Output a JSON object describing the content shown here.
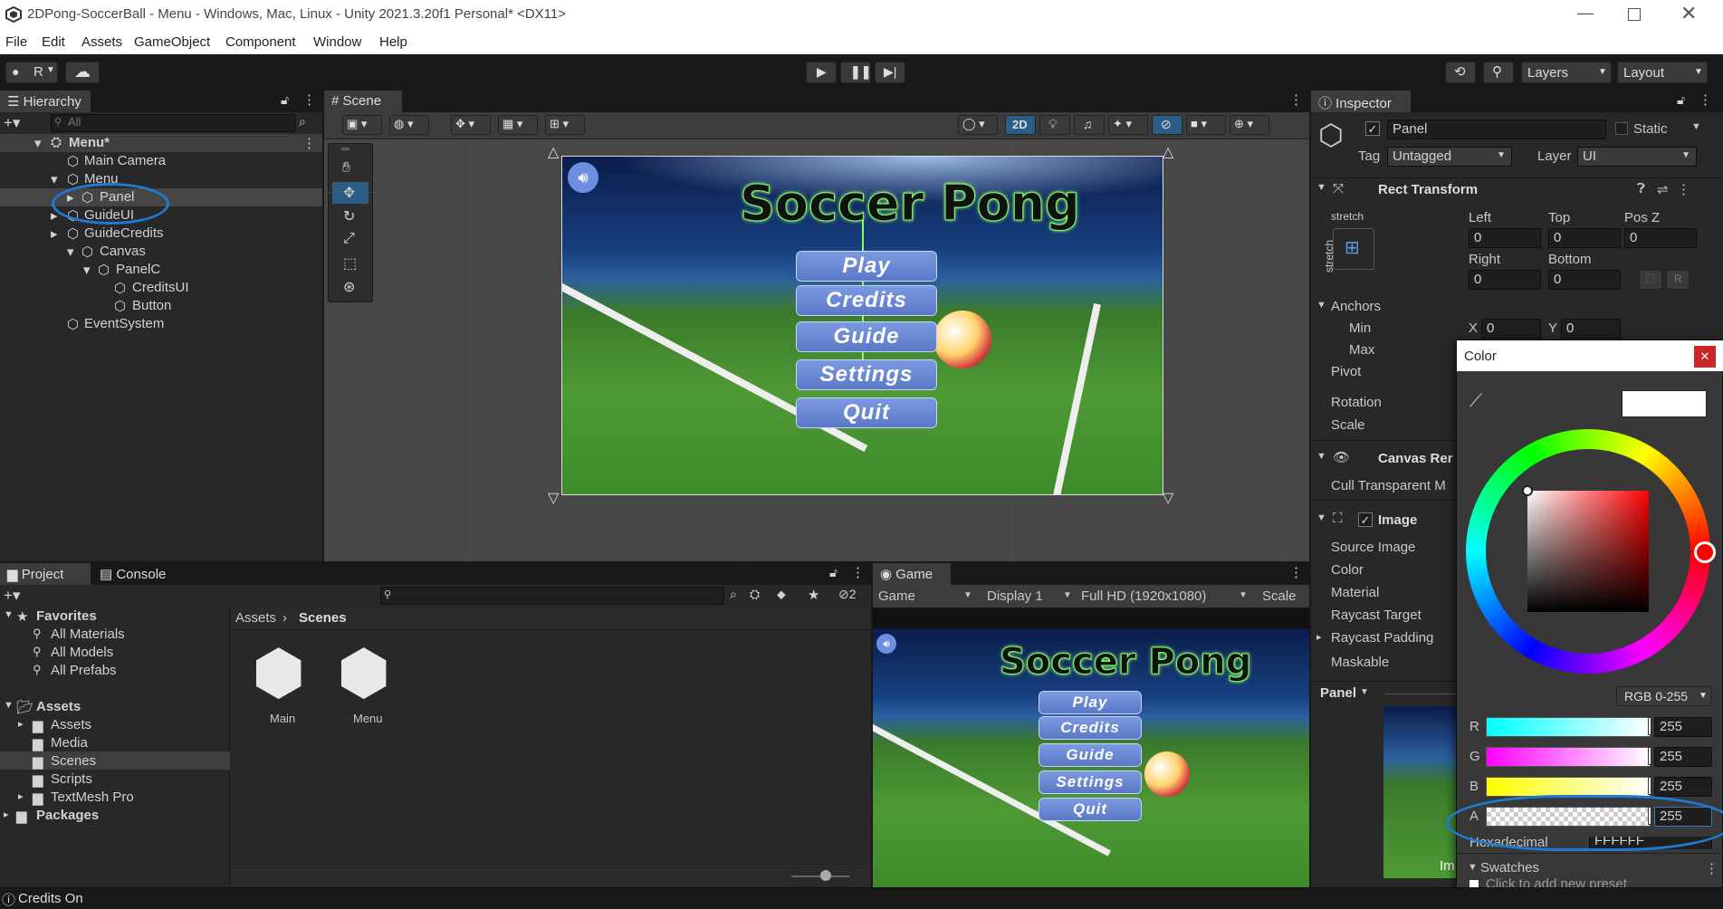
{
  "window": {
    "title": "2DPong-SoccerBall - Menu - Windows, Mac, Linux - Unity 2021.3.20f1 Personal* <DX11>"
  },
  "menubar": [
    "File",
    "Edit",
    "Assets",
    "GameObject",
    "Component",
    "Window",
    "Help"
  ],
  "toolbar": {
    "account": "R",
    "layers": "Layers",
    "layout": "Layout"
  },
  "hierarchy": {
    "tab": "Hierarchy",
    "search_placeholder": "All",
    "items": [
      {
        "label": "Menu*"
      },
      {
        "label": "Main Camera"
      },
      {
        "label": "Menu"
      },
      {
        "label": "Panel"
      },
      {
        "label": "GuideUI"
      },
      {
        "label": "GuideCredits"
      },
      {
        "label": "Canvas"
      },
      {
        "label": "PanelC"
      },
      {
        "label": "CreditsUI"
      },
      {
        "label": "Button"
      },
      {
        "label": "EventSystem"
      }
    ]
  },
  "scene": {
    "tab": "Scene",
    "mode2d": "2D"
  },
  "game_ui": {
    "title": "Soccer Pong",
    "buttons": [
      "Play",
      "Credits",
      "Guide",
      "Settings",
      "Quit"
    ]
  },
  "inspector": {
    "tab": "Inspector",
    "name": "Panel",
    "static_label": "Static",
    "tag_label": "Tag",
    "tag_value": "Untagged",
    "layer_label": "Layer",
    "layer_value": "UI",
    "rect_transform": "Rect Transform",
    "stretch_top": "stretch",
    "stretch_side": "stretch",
    "fields": {
      "left": "Left",
      "top": "Top",
      "posz": "Pos Z",
      "right": "Right",
      "bottom": "Bottom",
      "left_v": "0",
      "top_v": "0",
      "posz_v": "0",
      "right_v": "0",
      "bottom_v": "0"
    },
    "anchors": "Anchors",
    "min": "Min",
    "max": "Max",
    "min_x_label": "X",
    "min_x": "0",
    "min_y_label": "Y",
    "min_y": "0",
    "pivot": "Pivot",
    "rotation": "Rotation",
    "scale": "Scale",
    "canvas_renderer": "Canvas Rer",
    "cull": "Cull Transparent M",
    "image": "Image",
    "image_props": [
      "Source Image",
      "Color",
      "Material",
      "Raycast Target",
      "Raycast Padding",
      "Maskable"
    ],
    "preview_label": "Panel",
    "preview_text": "Im"
  },
  "color_picker": {
    "title": "Color",
    "mode": "RGB 0-255",
    "channels": [
      {
        "name": "R",
        "value": "255"
      },
      {
        "name": "G",
        "value": "255"
      },
      {
        "name": "B",
        "value": "255"
      },
      {
        "name": "A",
        "value": "255"
      }
    ],
    "hex_label": "Hexadecimal",
    "hex_value": "FFFFFF",
    "swatches": "Swatches",
    "swatch_hint": "Click to add new preset"
  },
  "project": {
    "tabs": [
      "Project",
      "Console"
    ],
    "favorites": "Favorites",
    "fav_items": [
      "All Materials",
      "All Models",
      "All Prefabs"
    ],
    "assets_root": "Assets",
    "asset_folders": [
      "Assets",
      "Media",
      "Scenes",
      "Scripts",
      "TextMesh Pro"
    ],
    "packages": "Packages",
    "breadcrumb": [
      "Assets",
      "Scenes"
    ],
    "files": [
      "Main",
      "Menu"
    ],
    "hidden_count": "2"
  },
  "game": {
    "tab": "Game",
    "view": "Game",
    "display": "Display 1",
    "resolution": "Full HD (1920x1080)",
    "scale": "Scale"
  },
  "status": {
    "text": "Credits On"
  },
  "colors": {
    "accent": "#2c5d87",
    "blue_ink": "#1e7bd4",
    "grass": "#3a8a2a"
  }
}
